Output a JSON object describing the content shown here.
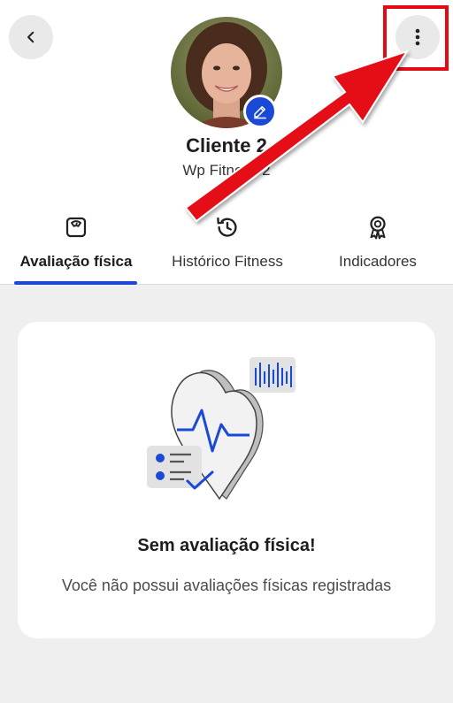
{
  "header": {
    "back_icon": "chevron-left-icon",
    "menu_icon": "more-vertical-icon",
    "edit_icon": "pencil-icon"
  },
  "profile": {
    "name": "Cliente 2",
    "subtitle": "Wp Fitness 2"
  },
  "tabs": [
    {
      "label": "Avaliação física",
      "icon": "scale-icon",
      "active": true
    },
    {
      "label": "Histórico Fitness",
      "icon": "history-icon",
      "active": false
    },
    {
      "label": "Indicadores",
      "icon": "award-icon",
      "active": false
    }
  ],
  "empty_state": {
    "title": "Sem avaliação física!",
    "description": "Você não possui avaliações físicas registradas"
  },
  "colors": {
    "accent": "#1a49d6",
    "highlight": "#e50914",
    "background": "#efefef"
  }
}
